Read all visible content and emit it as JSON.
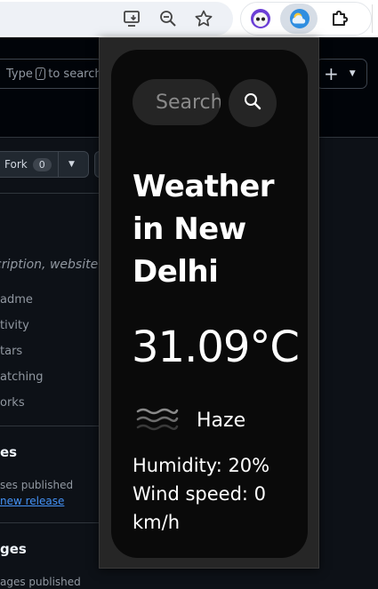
{
  "browser": {
    "toolbar_icons": [
      "install-app-icon",
      "zoom-out-icon",
      "bookmark-star-icon"
    ],
    "extensions": [
      "owl-extension-icon",
      "weather-extension-icon",
      "extensions-puzzle-icon"
    ]
  },
  "github": {
    "search_prefix": "Type",
    "search_key": "/",
    "search_suffix": "to search",
    "plus_label": "+",
    "fork_label": "Fork",
    "fork_count": "0",
    "description_text": "cription, website",
    "sidebar_items": [
      "adme",
      "tivity",
      "tars",
      "atching",
      "orks"
    ],
    "releases_heading": "es",
    "releases_note": "ses published",
    "releases_link": "new release",
    "packages_heading": "ges",
    "packages_note": "ages published"
  },
  "weather": {
    "search_placeholder": "Search",
    "title": "Weather in New Delhi",
    "temperature": "31.09°C",
    "condition": "Haze",
    "condition_icon": "haze-icon",
    "humidity": "Humidity: 20%",
    "wind": "Wind speed: 0 km/h",
    "colors": {
      "card": "#0a0a0a",
      "input": "#252525",
      "text": "#ffffff"
    }
  }
}
